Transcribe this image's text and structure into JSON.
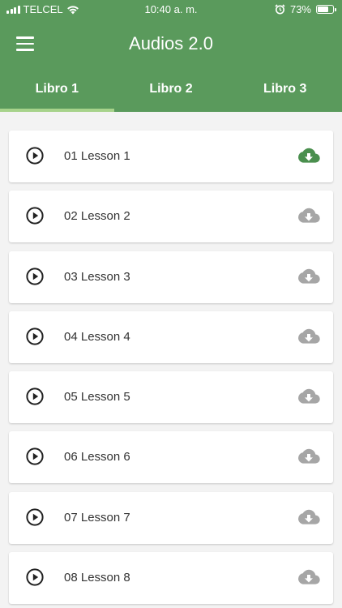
{
  "status_bar": {
    "carrier": "TELCEL",
    "time": "10:40 a. m.",
    "battery": "73%",
    "battery_level": 0.73
  },
  "app": {
    "title": "Audios 2.0"
  },
  "tabs": [
    {
      "label": "Libro 1",
      "active": true
    },
    {
      "label": "Libro 2",
      "active": false
    },
    {
      "label": "Libro 3",
      "active": false
    }
  ],
  "lessons": [
    {
      "label": "01 Lesson 1",
      "downloaded": true
    },
    {
      "label": "02 Lesson 2",
      "downloaded": false
    },
    {
      "label": "03 Lesson 3",
      "downloaded": false
    },
    {
      "label": "04 Lesson 4",
      "downloaded": false
    },
    {
      "label": "05 Lesson 5",
      "downloaded": false
    },
    {
      "label": "06 Lesson 6",
      "downloaded": false
    },
    {
      "label": "07 Lesson 7",
      "downloaded": false
    },
    {
      "label": "08 Lesson 8",
      "downloaded": false
    }
  ],
  "colors": {
    "primary": "#5a9a5c",
    "tab_indicator": "#a7d38b",
    "downloaded": "#4a8f4e",
    "not_downloaded": "#a6a6a6"
  },
  "icons": {
    "menu": "menu-icon",
    "play": "play-circle-icon",
    "download": "cloud-download-icon",
    "wifi": "wifi-icon",
    "alarm": "alarm-icon",
    "signal": "signal-icon",
    "battery": "battery-icon"
  }
}
